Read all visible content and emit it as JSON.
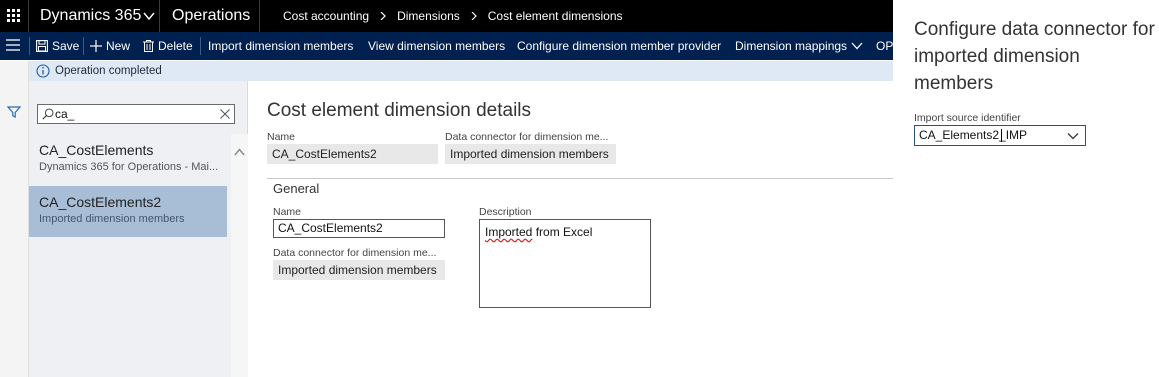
{
  "topbar": {
    "app_name": "Dynamics 365",
    "module": "Operations",
    "breadcrumbs": [
      "Cost accounting",
      "Dimensions",
      "Cost element dimensions"
    ]
  },
  "actions": {
    "save": "Save",
    "new": "New",
    "delete": "Delete",
    "import_members": "Import dimension members",
    "view_members": "View dimension members",
    "configure_provider": "Configure dimension member provider",
    "dimension_mappings": "Dimension mappings",
    "overflow": "OPT"
  },
  "message": {
    "text": "Operation completed"
  },
  "search": {
    "value": "ca_"
  },
  "list": {
    "items": [
      {
        "title": "CA_CostElements",
        "subtitle": "Dynamics 365 for Operations - Mai...",
        "selected": false
      },
      {
        "title": "CA_CostElements2",
        "subtitle": "Imported dimension members",
        "selected": true
      }
    ]
  },
  "details": {
    "title": "Cost element dimension details",
    "header": {
      "name_label": "Name",
      "name_value": "CA_CostElements2",
      "connector_label": "Data connector for dimension me...",
      "connector_value": "Imported dimension members"
    },
    "general": {
      "title": "General",
      "name_label": "Name",
      "name_value": "CA_CostElements2",
      "connector_label": "Data connector for dimension me...",
      "connector_value": "Imported dimension members",
      "description_label": "Description",
      "description_value": "Imported from Excel",
      "description_misspelled": "Imported",
      "description_rest": " from Excel"
    }
  },
  "flyout": {
    "title": "Configure data connector for imported dimension members",
    "field_label": "Import source identifier",
    "field_value": "CA_Elements2_IMP"
  },
  "colors": {
    "topbar": "#000000",
    "actionbar": "#002050",
    "message": "#dfe9f5",
    "selected_item": "#a8bdd6"
  }
}
